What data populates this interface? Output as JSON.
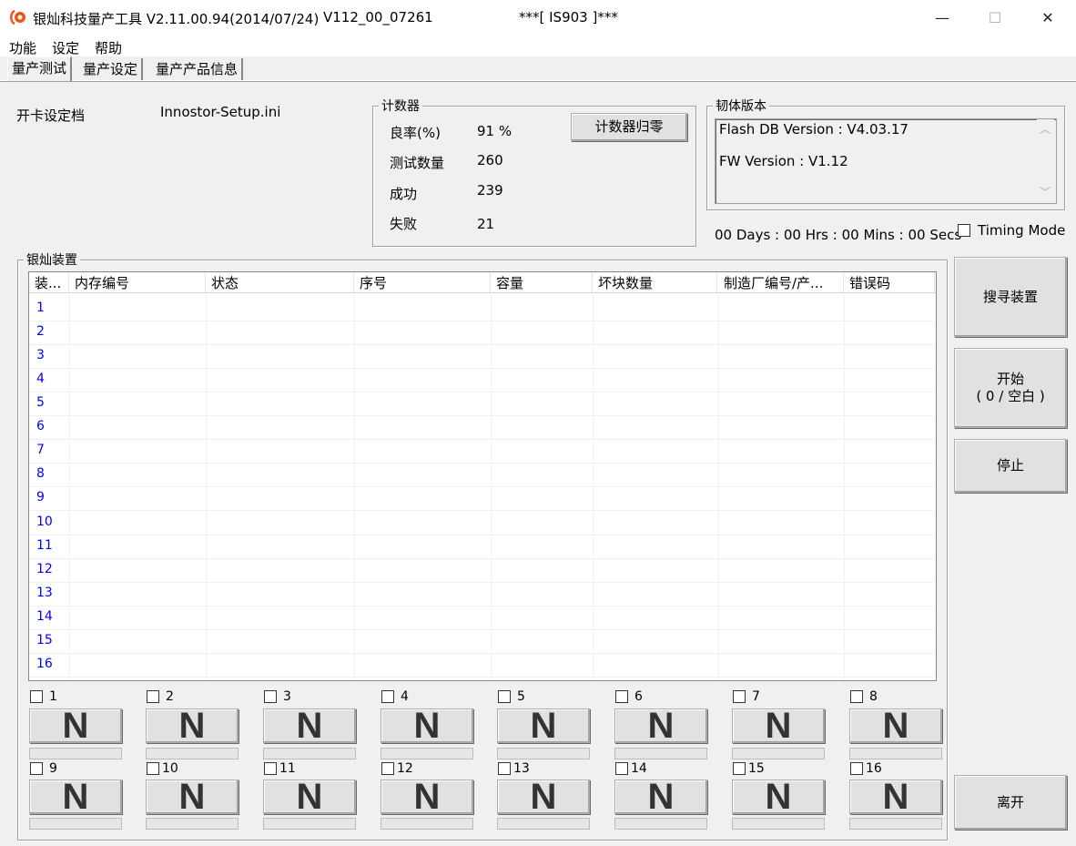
{
  "window": {
    "title": "银灿科技量产工具 V2.11.00.94(2014/07/24)",
    "version": "V112_00_07261",
    "chip": "***[ IS903 ]***",
    "minimize_glyph": "—",
    "maximize_glyph": "☐",
    "close_glyph": "✕"
  },
  "menu": [
    "功能",
    "设定",
    "帮助"
  ],
  "tabs": [
    "量产测试",
    "量产设定",
    "量产产品信息"
  ],
  "setting": {
    "label": "开卡设定档",
    "value": "Innostor-Setup.ini"
  },
  "counter": {
    "title": "计数器",
    "reset_label": "计数器归零",
    "rows": [
      {
        "label": "良率(%)",
        "value": "91 %"
      },
      {
        "label": "测试数量",
        "value": "260"
      },
      {
        "label": "成功",
        "value": "239"
      },
      {
        "label": "失败",
        "value": "21"
      }
    ]
  },
  "firmware": {
    "title": "韧体版本",
    "flash_db": "Flash DB Version :  V4.03.17",
    "fw": "FW Version :   V1.12",
    "scroll_up": "︿",
    "scroll_down": "﹀"
  },
  "timer": "00 Days : 00 Hrs : 00 Mins : 00 Secs",
  "timing_mode": "Timing Mode",
  "devices": {
    "title": "银灿装置",
    "columns": [
      "装...",
      "内存编号",
      "状态",
      "序号",
      "容量",
      "坏块数量",
      "制造厂编号/产...",
      "错误码"
    ],
    "rows": [
      "1",
      "2",
      "3",
      "4",
      "5",
      "6",
      "7",
      "8",
      "9",
      "10",
      "11",
      "12",
      "13",
      "14",
      "15",
      "16"
    ]
  },
  "ports": [
    {
      "label": "1",
      "state": "N"
    },
    {
      "label": "2",
      "state": "N"
    },
    {
      "label": "3",
      "state": "N"
    },
    {
      "label": "4",
      "state": "N"
    },
    {
      "label": "5",
      "state": "N"
    },
    {
      "label": "6",
      "state": "N"
    },
    {
      "label": "7",
      "state": "N"
    },
    {
      "label": "8",
      "state": "N"
    },
    {
      "label": "9",
      "state": "N"
    },
    {
      "label": "10",
      "state": "N"
    },
    {
      "label": "11",
      "state": "N"
    },
    {
      "label": "12",
      "state": "N"
    },
    {
      "label": "13",
      "state": "N"
    },
    {
      "label": "14",
      "state": "N"
    },
    {
      "label": "15",
      "state": "N"
    },
    {
      "label": "16",
      "state": "N"
    }
  ],
  "actions": {
    "search": "搜寻装置",
    "start_line1": "开始",
    "start_line2": "( 0 / 空白  )",
    "stop": "停止",
    "exit": "离开"
  },
  "colors": {
    "row_number": "#0000ff",
    "icon": "#e8541c"
  }
}
